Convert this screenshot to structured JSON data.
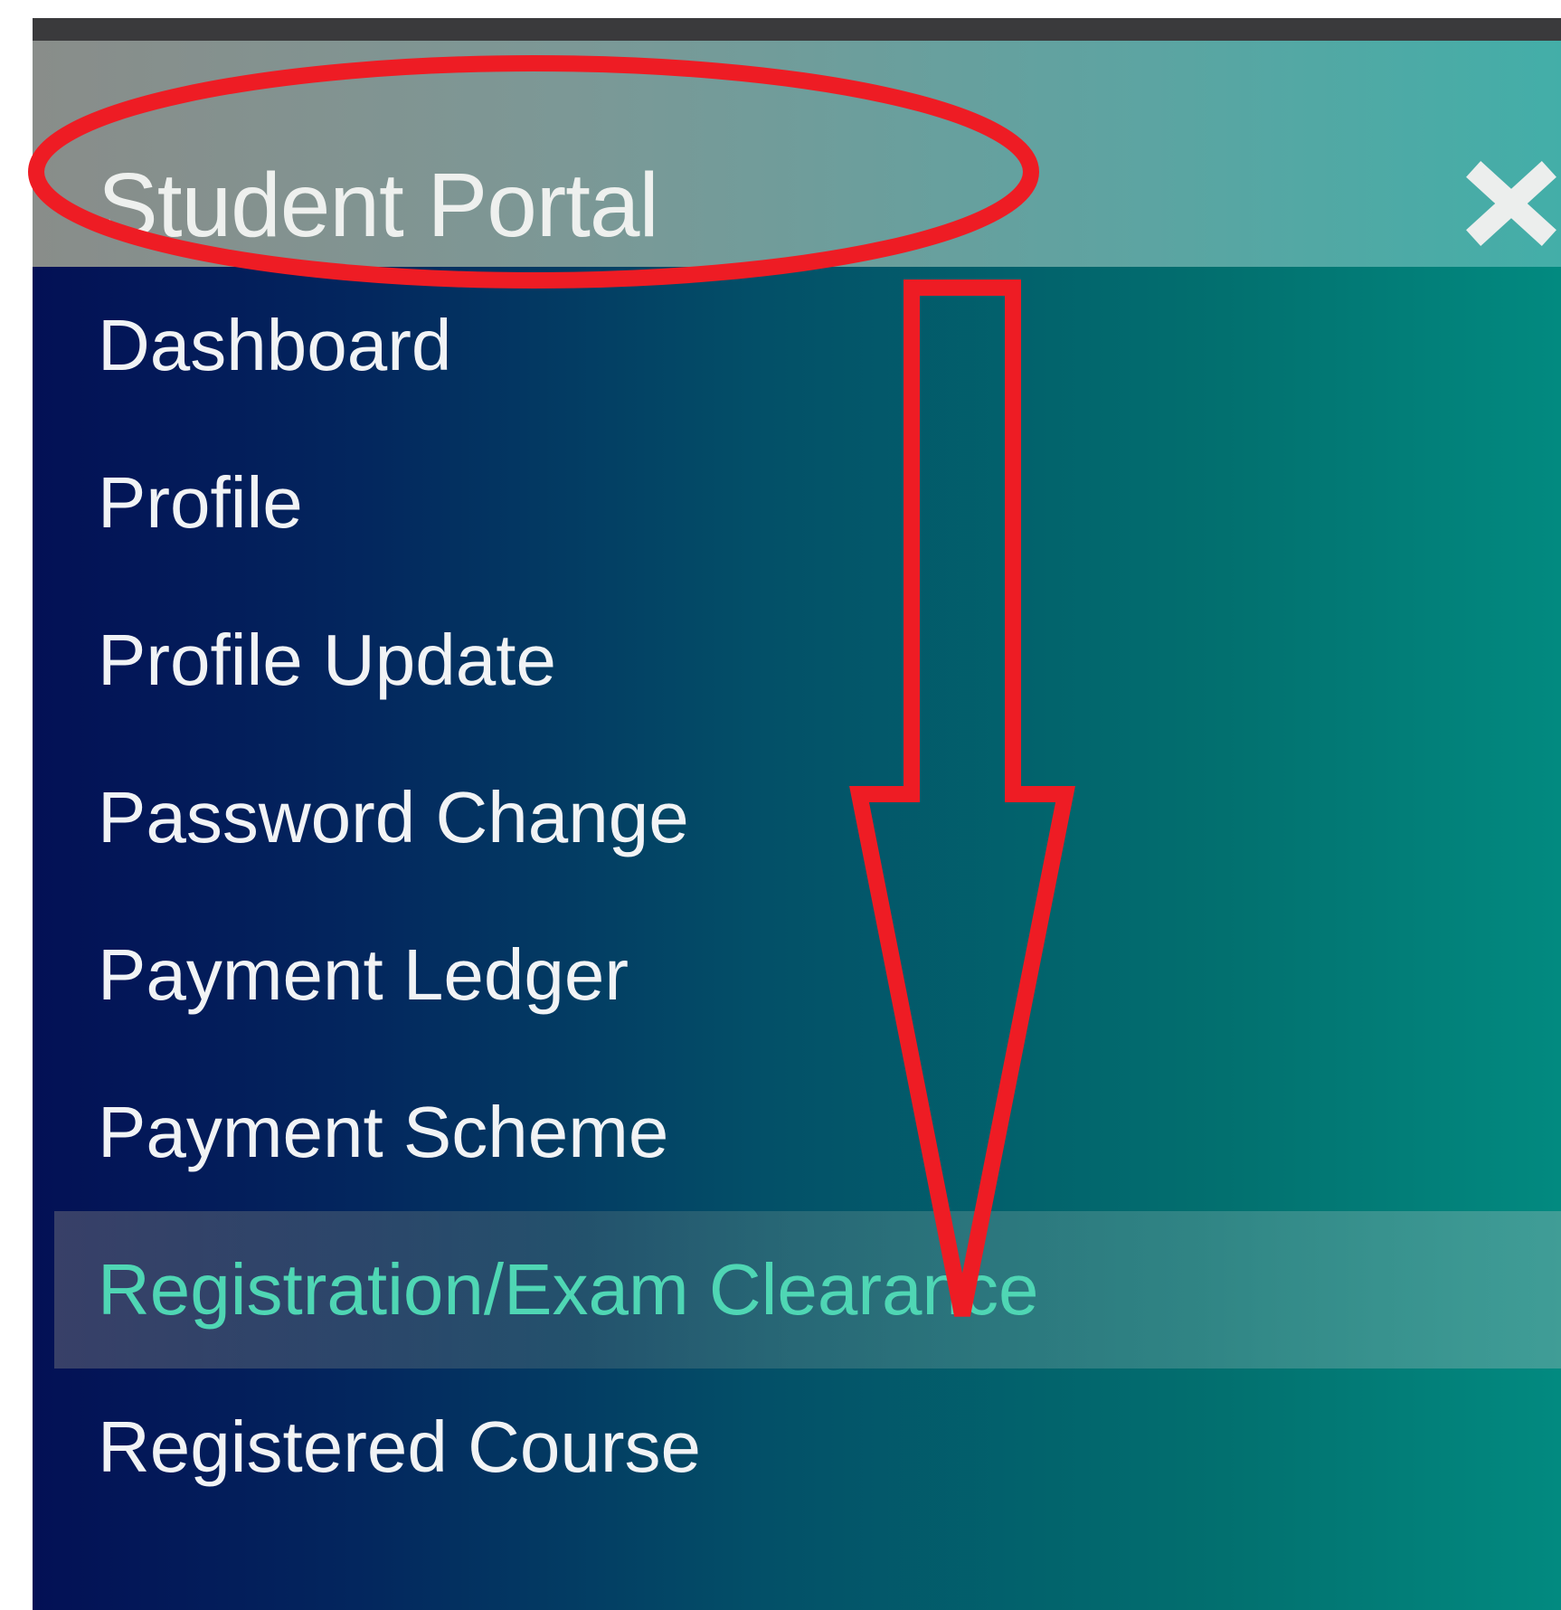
{
  "header": {
    "title": "Student Portal",
    "close_icon": "close-icon"
  },
  "menu": {
    "items": [
      {
        "label": "Dashboard",
        "active": false
      },
      {
        "label": "Profile",
        "active": false
      },
      {
        "label": "Profile Update",
        "active": false
      },
      {
        "label": "Password Change",
        "active": false
      },
      {
        "label": "Payment Ledger",
        "active": false
      },
      {
        "label": "Payment Scheme",
        "active": false
      },
      {
        "label": "Registration/Exam Clearance",
        "active": true
      },
      {
        "label": "Registered Course",
        "active": false
      }
    ]
  },
  "annotations": {
    "color": "#ee1c24",
    "shapes": [
      "ellipse-around-title",
      "down-arrow"
    ]
  },
  "colors": {
    "active_text": "#4fd6b4",
    "menu_text": "#f1f3f5",
    "header_text": "#eef0ee"
  }
}
